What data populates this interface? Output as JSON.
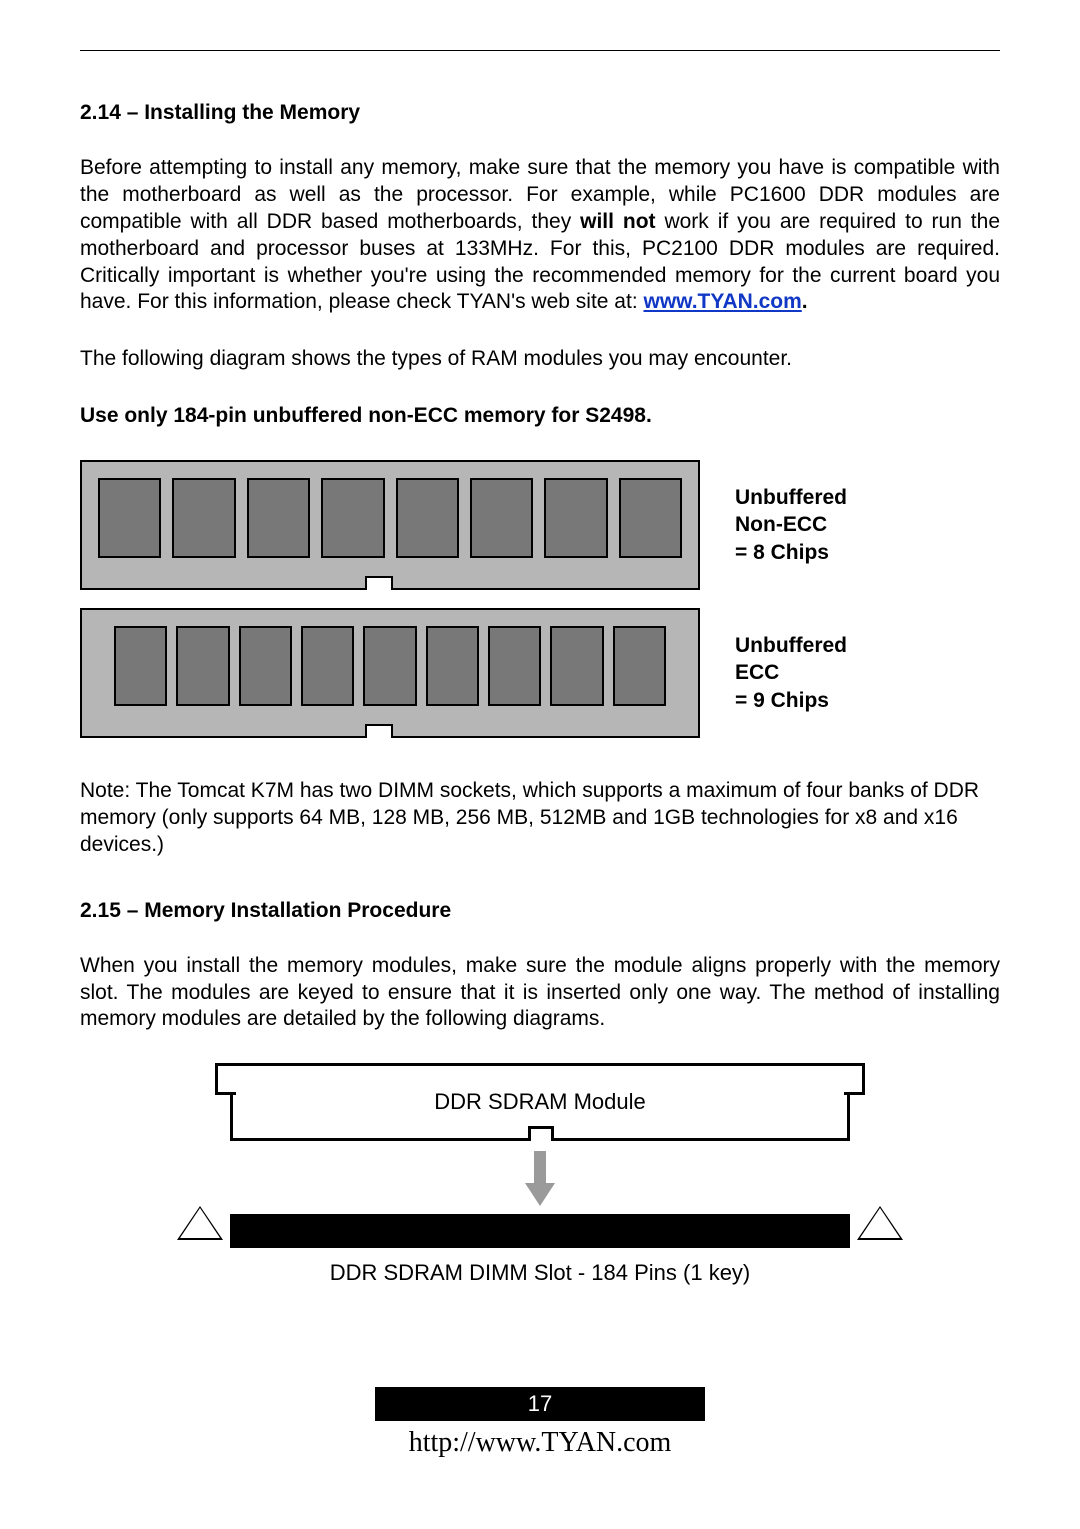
{
  "section1": {
    "heading": "2.14 – Installing the Memory",
    "para1_a": "Before attempting to install any memory, make sure that the memory you have is compatible with the motherboard as well as the processor. For example, while PC1600 DDR modules are compatible with all DDR based motherboards, they ",
    "para1_bold": "will not",
    "para1_b": " work if you are required to run the motherboard and processor buses at 133MHz. For this, PC2100 DDR modules are required. Critically important is whether you're using the recommended memory for the current board you have. For this information, please check TYAN's web site at: ",
    "link_text": "www.TYAN.com",
    "period": ".",
    "para2": "The following diagram shows the types of RAM modules you may encounter.",
    "para3": "Use only 184-pin unbuffered non-ECC memory for S2498.",
    "ram_label_1a": "Unbuffered",
    "ram_label_1b": "Non-ECC",
    "ram_label_1c": "= 8 Chips",
    "ram_label_2a": "Unbuffered",
    "ram_label_2b": "ECC",
    "ram_label_2c": "= 9 Chips",
    "note": "Note: The Tomcat K7M has two DIMM sockets, which supports a maximum of four banks of DDR memory (only supports 64 MB, 128 MB, 256 MB, 512MB and 1GB technologies for x8 and x16 devices.)"
  },
  "section2": {
    "heading": "2.15 – Memory Installation Procedure",
    "para1": "When you install the memory modules, make sure the module aligns properly with the memory slot. The modules are keyed to ensure that it is inserted only one way. The method of installing memory modules are detailed by the following diagrams.",
    "module_label": "DDR SDRAM Module",
    "slot_label": "DDR SDRAM DIMM Slot - 184 Pins (1 key)"
  },
  "footer": {
    "page_number": "17",
    "url": "http://www.TYAN.com"
  }
}
